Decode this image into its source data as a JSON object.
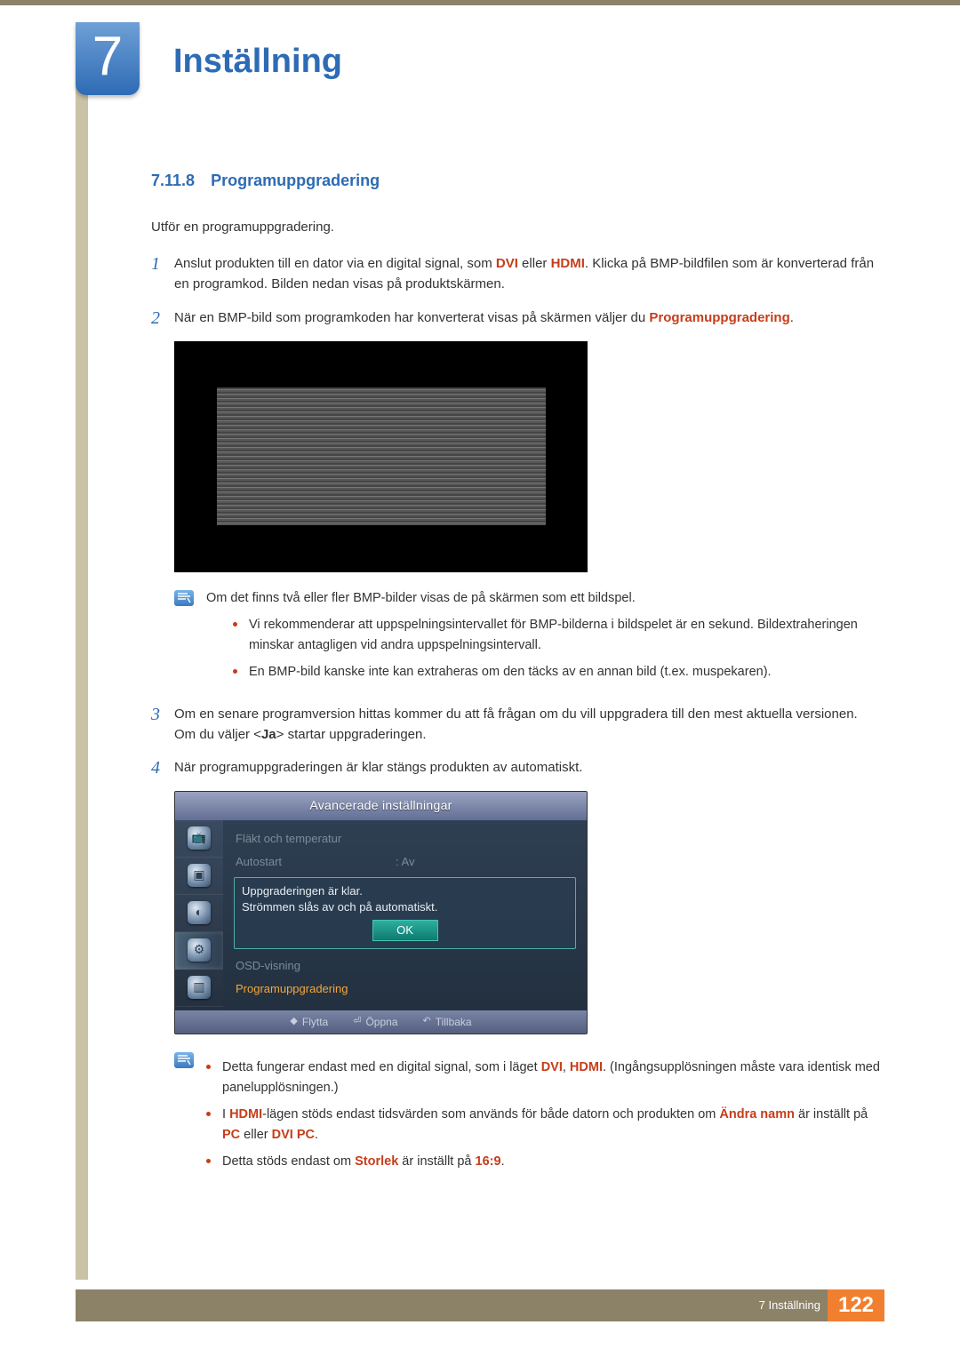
{
  "chapter": {
    "number": "7",
    "title": "Inställning"
  },
  "section": {
    "number": "7.11.8",
    "title": "Programuppgradering"
  },
  "intro": "Utför en programuppgradering.",
  "steps": {
    "s1": {
      "num": "1",
      "pre": "Anslut produkten till en dator via en digital signal, som ",
      "dvi": "DVI",
      "mid1": " eller ",
      "hdmi": "HDMI",
      "post": ". Klicka på BMP-bildfilen som är konverterad från en programkod. Bilden nedan visas på produktskärmen."
    },
    "s2": {
      "num": "2",
      "pre": "När en BMP-bild som programkoden har konverterat visas på skärmen väljer du ",
      "link": "Programuppgradering",
      "dot": "."
    },
    "s3": {
      "num": "3",
      "pre": "Om en senare programversion hittas kommer du att få frågan om du vill uppgradera till den mest aktuella versionen. Om du väljer <",
      "ja": "Ja",
      "post": "> startar uppgraderingen."
    },
    "s4": {
      "num": "4",
      "text": "När programuppgraderingen är klar stängs produkten av automatiskt."
    }
  },
  "note1": {
    "lead": "Om det finns två eller fler BMP-bilder visas de på skärmen som ett bildspel.",
    "b1": "Vi rekommenderar att uppspelningsintervallet för BMP-bilderna i bildspelet är en sekund. Bildextraheringen minskar antagligen vid andra uppspelningsintervall.",
    "b2": "En BMP-bild kanske inte kan extraheras om den täcks av en annan bild (t.ex. muspekaren)."
  },
  "note2": {
    "b1a": "Detta fungerar endast med en digital signal, som i läget ",
    "b1_dvi": "DVI",
    "b1_comma": ", ",
    "b1_hdmi": "HDMI",
    "b1b": ". (Ingångsupplösningen måste vara identisk med panelupplösningen.)",
    "b2a": "I ",
    "b2_hdmi": "HDMI",
    "b2b": "-lägen stöds endast tidsvärden som används för både datorn och produkten om ",
    "b2_change": "Ändra namn",
    "b2c": " är inställt på ",
    "b2_pc": "PC",
    "b2d": " eller ",
    "b2_dvipc": "DVI PC",
    "b2e": ".",
    "b3a": "Detta stöds endast om ",
    "b3_size": "Storlek",
    "b3b": " är inställt på ",
    "b3_ratio": "16:9",
    "b3c": "."
  },
  "osd": {
    "title": "Avancerade inställningar",
    "line1": "Fläkt och temperatur",
    "line2_label": "Autostart",
    "line2_value": ": Av",
    "popup_l1": "Uppgraderingen är klar.",
    "popup_l2": "Strömmen slås av och på automatiskt.",
    "ok": "OK",
    "line3": "OSD-visning",
    "line4": "Programuppgradering",
    "foot_move": "Flytta",
    "foot_open": "Öppna",
    "foot_back": "Tillbaka"
  },
  "footer": {
    "chapter_label": "7 Inställning",
    "page": "122"
  }
}
